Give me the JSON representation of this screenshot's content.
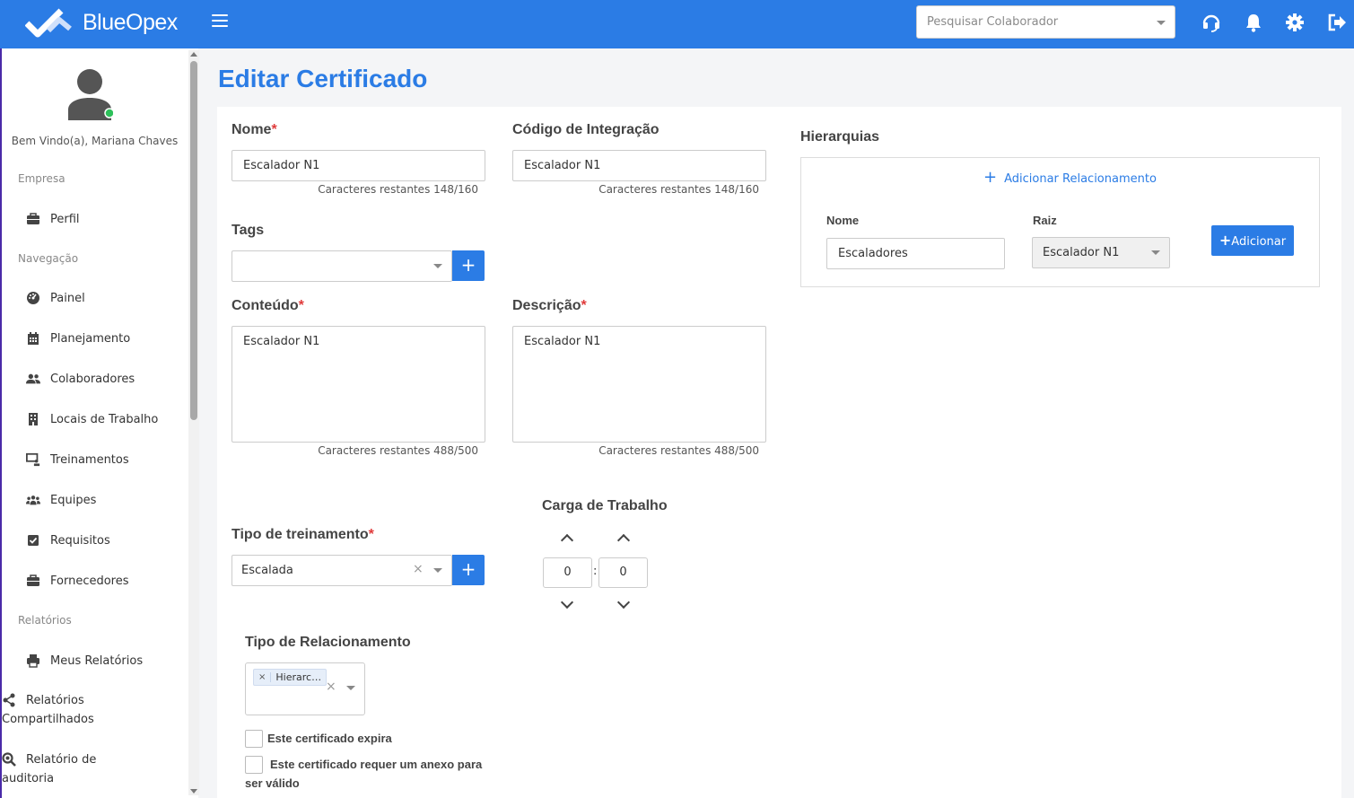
{
  "app": {
    "brand": "BlueOpex"
  },
  "header": {
    "search_placeholder": "Pesquisar Colaborador",
    "icons": [
      "headset-icon",
      "bell-icon",
      "gear-icon",
      "logout-icon"
    ]
  },
  "sidebar": {
    "welcome": "Bem Vindo(a), Mariana Chaves",
    "sections": {
      "empresa": "Empresa",
      "navegacao": "Navegação",
      "relatorios": "Relatórios"
    },
    "items": {
      "perfil": "Perfil",
      "painel": "Painel",
      "planejamento": "Planejamento",
      "colaboradores": "Colaboradores",
      "locais": "Locais de Trabalho",
      "treinamentos": "Treinamentos",
      "equipes": "Equipes",
      "requisitos": "Requisitos",
      "fornecedores": "Fornecedores",
      "meus_relatorios": "Meus Relatórios",
      "relatorios_compartilhados_1": "Relatórios",
      "relatorios_compartilhados_2": "Compartilhados",
      "auditoria_1": "Relatório de",
      "auditoria_2": "auditoria"
    }
  },
  "page": {
    "title": "Editar Certificado"
  },
  "form": {
    "nome": {
      "label": "Nome",
      "value": "Escalador N1",
      "counter": "Caracteres restantes 148/160"
    },
    "codigo": {
      "label": "Código de Integração",
      "value": "Escalador N1",
      "counter": "Caracteres restantes 148/160"
    },
    "tags": {
      "label": "Tags",
      "value": ""
    },
    "conteudo": {
      "label": "Conteúdo",
      "value": "Escalador N1",
      "counter": "Caracteres restantes 488/500"
    },
    "descricao": {
      "label": "Descrição",
      "value": "Escalador N1",
      "counter": "Caracteres restantes 488/500"
    },
    "tipo_treinamento": {
      "label": "Tipo de treinamento",
      "value": "Escalada"
    },
    "carga": {
      "label": "Carga de Trabalho",
      "hours": "0",
      "minutes": "0",
      "separator": ":"
    },
    "tipo_relacionamento": {
      "label": "Tipo de Relacionamento",
      "chip": "Hierarc…"
    },
    "expira_label": "Este certificado expira",
    "anexo_label_1": "Este certificado requer um anexo para",
    "anexo_label_2": "ser válido",
    "required_mark": "*",
    "plus": "+",
    "clear": "×"
  },
  "hierarquias": {
    "title": "Hierarquias",
    "add_link": "Adicionar Relacionamento",
    "nome_label": "Nome",
    "nome_value": "Escaladores",
    "raiz_label": "Raiz",
    "raiz_value": "Escalador N1",
    "add_button": "Adicionar"
  }
}
